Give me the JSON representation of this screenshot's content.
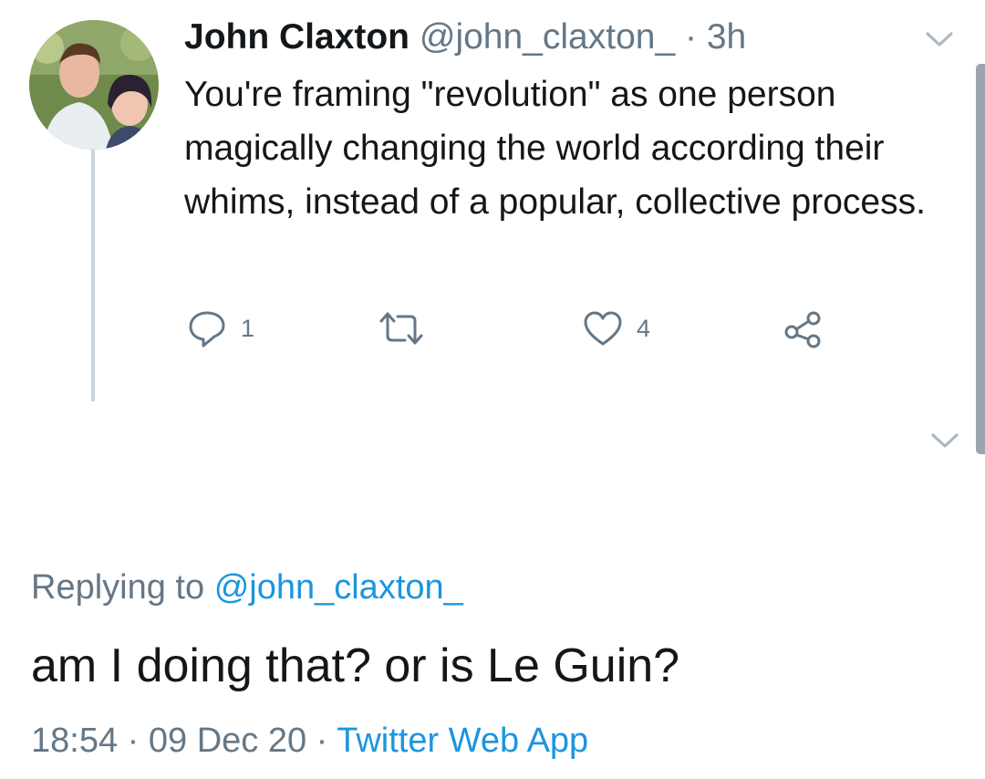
{
  "tweet": {
    "author_name": "John Claxton",
    "author_handle": "@john_claxton_",
    "separator": "·",
    "time_ago": "3h",
    "text": "You're framing \"revolution\" as one person magically changing the world according their whims, instead of a popular, collective process.",
    "actions": {
      "reply_count": "1",
      "retweet_count": "",
      "like_count": "4"
    }
  },
  "reply": {
    "replying_prefix": "Replying to",
    "replying_handle": "@john_claxton_",
    "text": "am I doing that? or is Le Guin?",
    "time": "18:54",
    "separator": "·",
    "date": "09 Dec 20",
    "separator2": "·",
    "source": "Twitter Web App"
  },
  "icons": {
    "reply": "reply-icon",
    "retweet": "retweet-icon",
    "like": "heart-icon",
    "share": "share-icon",
    "caret": "chevron-down-icon"
  },
  "colors": {
    "text": "#14171a",
    "secondary": "#657786",
    "link": "#1b95e0",
    "thread_line": "#ccd6dd"
  }
}
